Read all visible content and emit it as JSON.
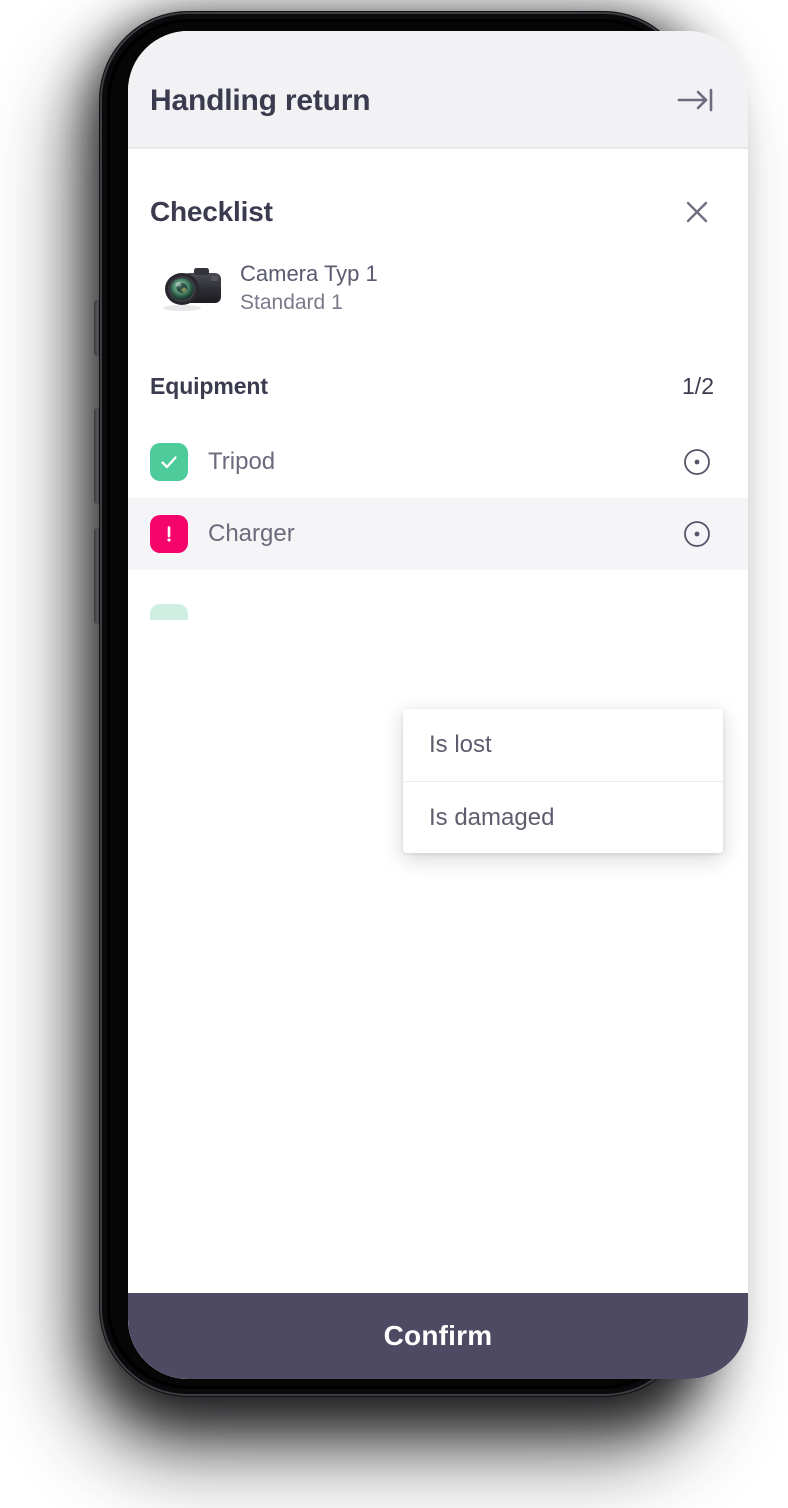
{
  "header": {
    "title": "Handling return",
    "action_icon": "arrow-to-line-icon"
  },
  "sheet": {
    "title": "Checklist",
    "close_icon": "close-icon"
  },
  "product": {
    "thumb_icon": "camera-thumbnail",
    "name": "Camera Typ 1",
    "subtitle": "Standard 1"
  },
  "section": {
    "title": "Equipment",
    "count": "1/2"
  },
  "checklist": [
    {
      "label": "Tripod",
      "state": "done",
      "badge_icon": "check-icon",
      "action_icon": "info-dot-icon"
    },
    {
      "label": "Charger",
      "state": "issue",
      "badge_icon": "exclamation-icon",
      "action_icon": "info-dot-icon"
    }
  ],
  "dropdown": {
    "items": [
      {
        "label": "Is lost"
      },
      {
        "label": "Is damaged"
      }
    ]
  },
  "footer": {
    "confirm_label": "Confirm"
  },
  "colors": {
    "header_bg": "#f2f2f4",
    "title": "#3b3b4f",
    "done_green": "#4ecb9a",
    "issue_pink": "#f5056b",
    "confirm_bar": "#4e4a63",
    "row_highlight": "#f5f5f7"
  }
}
